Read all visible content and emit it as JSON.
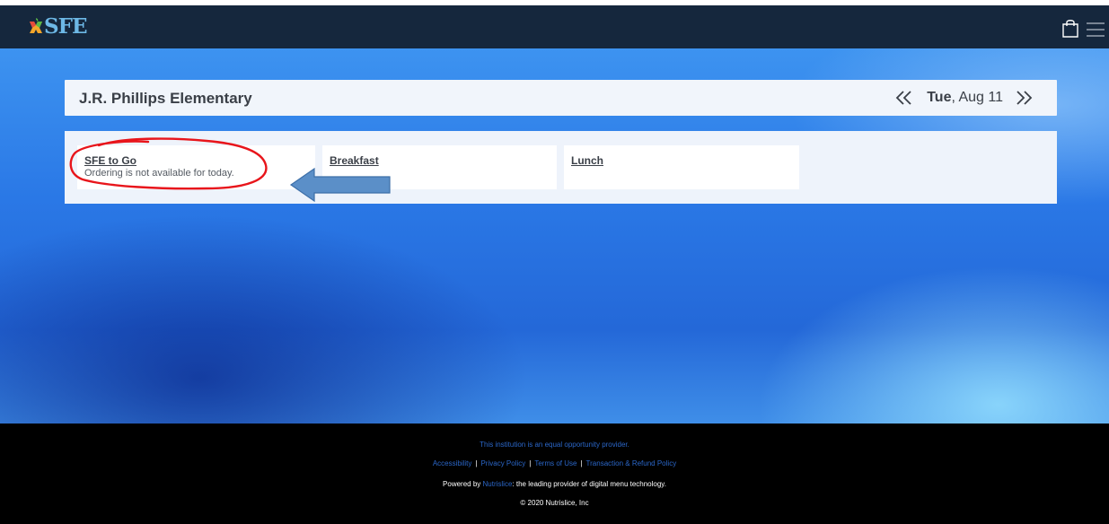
{
  "header": {
    "logo_text": "SFE",
    "logo_icon": "sfe-apple-logo-icon",
    "cart_icon": "shopping-bag-icon",
    "menu_icon": "hamburger-menu-icon"
  },
  "school": {
    "name": "J.R. Phillips Elementary",
    "date": {
      "day": "Tue",
      "rest": ", Aug 11"
    },
    "prev_icon": "double-chevron-left-icon",
    "next_icon": "double-chevron-right-icon"
  },
  "menus": [
    {
      "title": "SFE to Go",
      "subtitle": "Ordering is not available for today."
    },
    {
      "title": "Breakfast",
      "subtitle": ""
    },
    {
      "title": "Lunch",
      "subtitle": ""
    }
  ],
  "footer": {
    "equal_opportunity": "This institution is an equal opportunity provider.",
    "links": [
      "Accessibility",
      "Privacy Policy",
      "Terms of Use",
      "Transaction & Refund Policy"
    ],
    "separator": "|",
    "powered_prefix": "Powered by ",
    "powered_link": "Nutrislice",
    "powered_suffix": ": the leading provider of digital menu technology.",
    "copyright": "© 2020 Nutrislice, Inc"
  },
  "colors": {
    "topbar": "#15273d",
    "logo_blue": "#6db8e6",
    "annotation_red": "#e8151b",
    "annotation_arrow": "#5b8fc8"
  }
}
